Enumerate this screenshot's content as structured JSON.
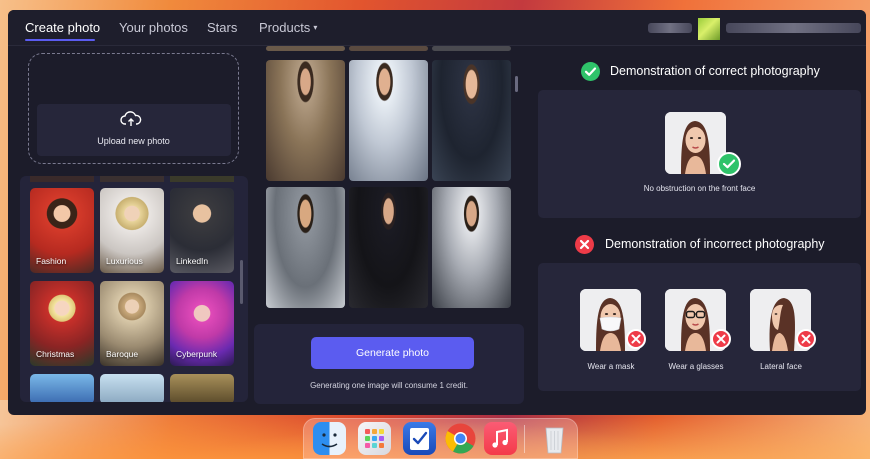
{
  "nav": {
    "tabs": [
      {
        "label": "Create photo",
        "active": true
      },
      {
        "label": "Your photos"
      },
      {
        "label": "Stars"
      },
      {
        "label": "Products"
      }
    ],
    "products_caret": "▾"
  },
  "upload": {
    "label": "Upload new photo",
    "icon": "cloud-upload-icon"
  },
  "styles": {
    "tiles": [
      {
        "label": "Fashion"
      },
      {
        "label": "Luxurious"
      },
      {
        "label": "LinkedIn"
      },
      {
        "label": "Christmas"
      },
      {
        "label": "Baroque"
      },
      {
        "label": "Cyberpunk"
      }
    ]
  },
  "generate": {
    "button_label": "Generate photo",
    "note": "Generating one image will consume 1 credit."
  },
  "correct": {
    "title": "Demonstration of correct photography",
    "caption": "No obstruction on the front face"
  },
  "incorrect": {
    "title": "Demonstration of incorrect photography",
    "items": [
      {
        "caption": "Wear a mask"
      },
      {
        "caption": "Wear a glasses"
      },
      {
        "caption": "Lateral face"
      }
    ]
  },
  "colors": {
    "accent": "#5b5cf0",
    "ok": "#2fc36a",
    "bad": "#ee3b48",
    "background": "#1c1c2a"
  },
  "dock": {
    "apps": [
      "finder-icon",
      "launchpad-icon",
      "tasks-icon",
      "chrome-icon",
      "music-icon",
      "trash-icon"
    ]
  }
}
